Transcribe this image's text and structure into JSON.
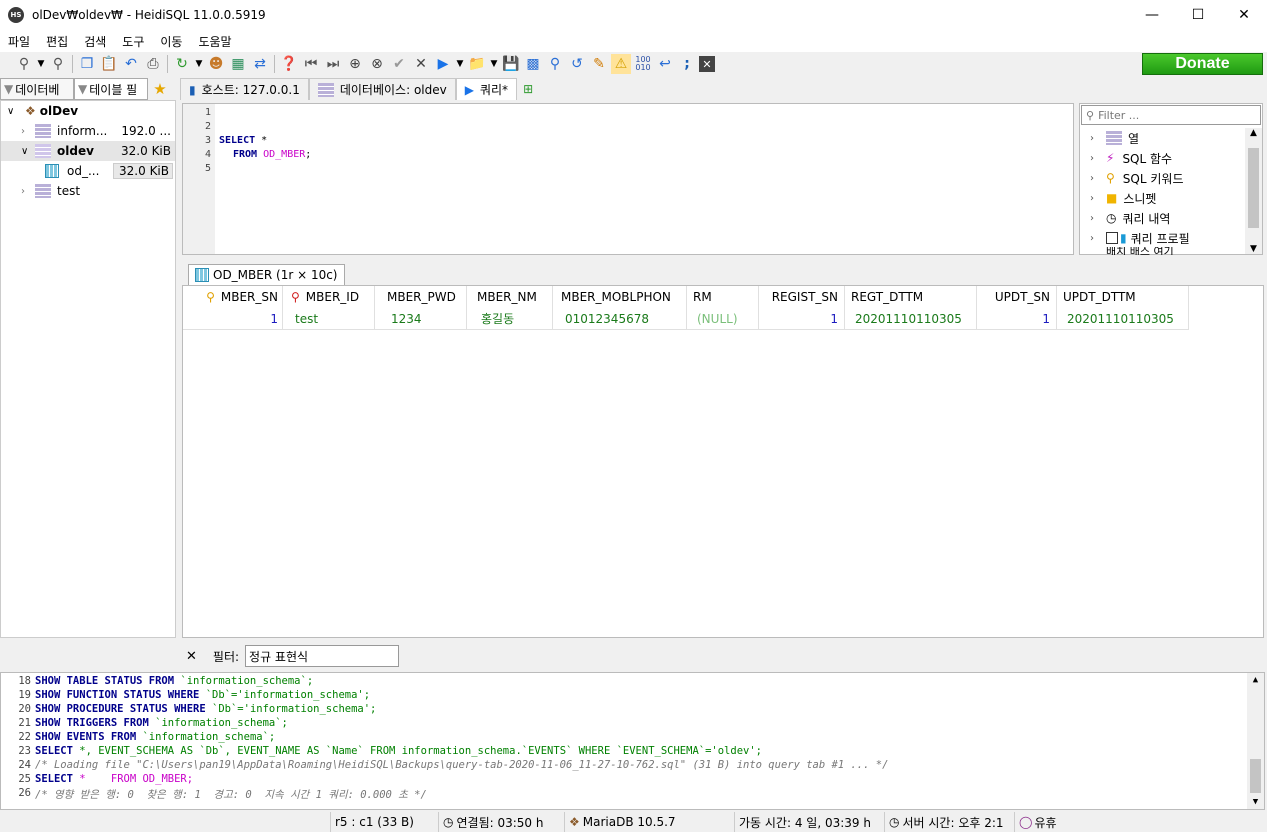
{
  "window": {
    "title": "olDev₩oldev₩ - HeidiSQL 11.0.0.5919",
    "app_icon": "HS"
  },
  "menu": [
    "파일",
    "편집",
    "검색",
    "도구",
    "이동",
    "도움말"
  ],
  "donate_label": "Donate",
  "left_tabs": [
    "데이터베",
    "테이블 필"
  ],
  "tree": {
    "root": "olDev",
    "items": [
      {
        "name": "inform...",
        "size": "192.0 ..."
      },
      {
        "name": "oldev",
        "size": "32.0 KiB"
      },
      {
        "name": "od_...",
        "size": "32.0 KiB"
      },
      {
        "name": "test",
        "size": ""
      }
    ]
  },
  "tabs": [
    "호스트: 127.0.0.1",
    "데이터베이스: oldev",
    "쿼리*"
  ],
  "editor": {
    "line_numbers": [
      "1",
      "2",
      "3",
      "4",
      "5"
    ],
    "select_kw": "SELECT",
    "select_rest": " *",
    "from_kw": "FROM",
    "table": "OD_MBER",
    "semi": ";"
  },
  "helper": {
    "filter_placeholder": "Filter ...",
    "items": [
      "열",
      "SQL 함수",
      "SQL 키워드",
      "스니펫",
      "쿼리 내역",
      "쿼리 프로필",
      "배치 배스 여기"
    ]
  },
  "result_tab": "OD_MBER (1r × 10c)",
  "grid": {
    "columns": [
      "MBER_SN",
      "MBER_ID",
      "MBER_PWD",
      "MBER_NM",
      "MBER_MOBLPHON",
      "RM",
      "REGIST_SN",
      "REGT_DTTM",
      "UPDT_SN",
      "UPDT_DTTM"
    ],
    "row": [
      "1",
      "test",
      "1234",
      "홍길동",
      "01012345678",
      "(NULL)",
      "1",
      "20201110110305",
      "1",
      "20201110110305"
    ]
  },
  "filter": {
    "label": "필터:",
    "placeholder": "정규 표현식"
  },
  "log": [
    {
      "n": "18",
      "a": "SHOW TABLE STATUS FROM",
      "b": " `information_schema`;"
    },
    {
      "n": "19",
      "a": "SHOW FUNCTION STATUS WHERE",
      "b": " `Db`='information_schema';"
    },
    {
      "n": "20",
      "a": "SHOW PROCEDURE STATUS WHERE",
      "b": " `Db`='information_schema';"
    },
    {
      "n": "21",
      "a": "SHOW TRIGGERS FROM",
      "b": " `information_schema`;"
    },
    {
      "n": "22",
      "a": "SHOW EVENTS FROM",
      "b": " `information_schema`;"
    },
    {
      "n": "23",
      "a": "SELECT",
      "b": " *, EVENT_SCHEMA AS `Db`, EVENT_NAME AS `Name` FROM information_schema.`EVENTS` WHERE `EVENT_SCHEMA`='oldev';"
    },
    {
      "n": "24",
      "c": "/* Loading file \"C:\\Users\\pan19\\AppData\\Roaming\\HeidiSQL\\Backups\\query-tab-2020-11-06_11-27-10-762.sql\" (31 B) into query tab #1 ... */"
    },
    {
      "n": "25",
      "a": "SELECT",
      "b": " *    FROM OD_MBER;"
    },
    {
      "n": "26",
      "c": "/* 영향 받은 행: 0  찾은 행: 1  경고: 0  지속 시간 1 쿼리: 0.000 초 */"
    }
  ],
  "status": [
    "r5 : c1 (33 B)",
    "연결됨: 03:50 h",
    "MariaDB 10.5.7",
    "가동 시간: 4 일, 03:39 h",
    "서버 시간: 오후 2:1",
    "유휴"
  ]
}
